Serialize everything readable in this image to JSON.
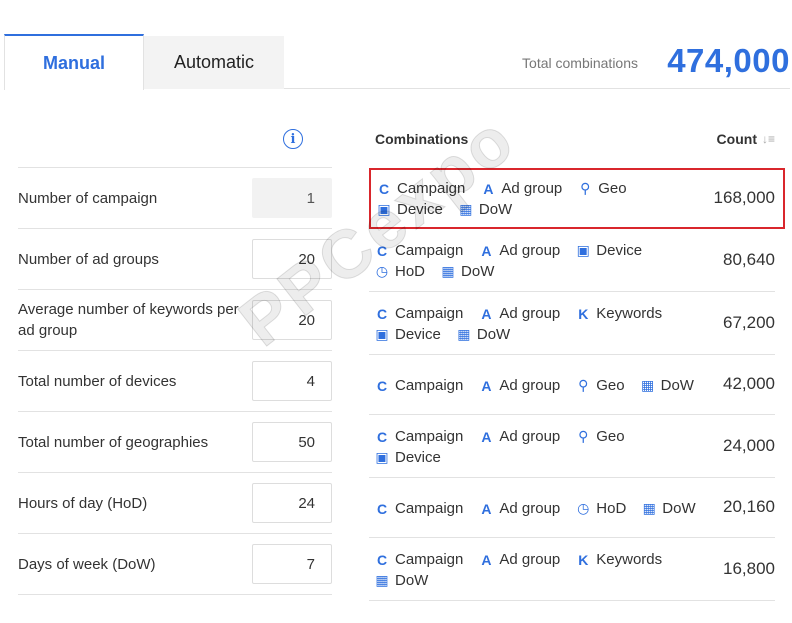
{
  "tabs": [
    {
      "label": "Manual",
      "active": true
    },
    {
      "label": "Automatic",
      "active": false
    }
  ],
  "total": {
    "label": "Total combinations",
    "value": "474,000"
  },
  "params": [
    {
      "label": "Number of campaign",
      "value": "1",
      "readonly": true
    },
    {
      "label": "Number of ad groups",
      "value": "20",
      "readonly": false
    },
    {
      "label": "Average number of keywords per ad group",
      "value": "20",
      "readonly": false
    },
    {
      "label": "Total number of devices",
      "value": "4",
      "readonly": false
    },
    {
      "label": "Total number of geographies",
      "value": "50",
      "readonly": false
    },
    {
      "label": "Hours of day (HoD)",
      "value": "24",
      "readonly": false
    },
    {
      "label": "Days of week (DoW)",
      "value": "7",
      "readonly": false
    }
  ],
  "combinations": {
    "title": "Combinations",
    "count_title": "Count",
    "rows": [
      {
        "lines": [
          [
            "Campaign",
            "Ad group",
            "Geo"
          ],
          [
            "Device",
            "DoW"
          ]
        ],
        "count": "168,000",
        "selected": true
      },
      {
        "lines": [
          [
            "Campaign",
            "Ad group",
            "Device"
          ],
          [
            "HoD",
            "DoW"
          ]
        ],
        "count": "80,640",
        "selected": false
      },
      {
        "lines": [
          [
            "Campaign",
            "Ad group",
            "Keywords"
          ],
          [
            "Device",
            "DoW"
          ]
        ],
        "count": "67,200",
        "selected": false
      },
      {
        "lines": [
          [
            "Campaign",
            "Ad group",
            "Geo",
            "DoW"
          ]
        ],
        "count": "42,000",
        "selected": false
      },
      {
        "lines": [
          [
            "Campaign",
            "Ad group",
            "Geo"
          ],
          [
            "Device"
          ]
        ],
        "count": "24,000",
        "selected": false
      },
      {
        "lines": [
          [
            "Campaign",
            "Ad group",
            "HoD",
            "DoW"
          ]
        ],
        "count": "20,160",
        "selected": false
      },
      {
        "lines": [
          [
            "Campaign",
            "Ad group",
            "Keywords"
          ],
          [
            "DoW"
          ]
        ],
        "count": "16,800",
        "selected": false
      }
    ]
  },
  "icons": {
    "Campaign": "campaign-icon",
    "Ad group": "ad-group-icon",
    "Geo": "geo-pin-icon",
    "Device": "device-icon",
    "DoW": "calendar-icon",
    "HoD": "clock-icon",
    "Keywords": "keywords-icon"
  },
  "watermark": "PPCexpo",
  "colors": {
    "accent": "#2f6fde",
    "selected_border": "#d9262c"
  }
}
